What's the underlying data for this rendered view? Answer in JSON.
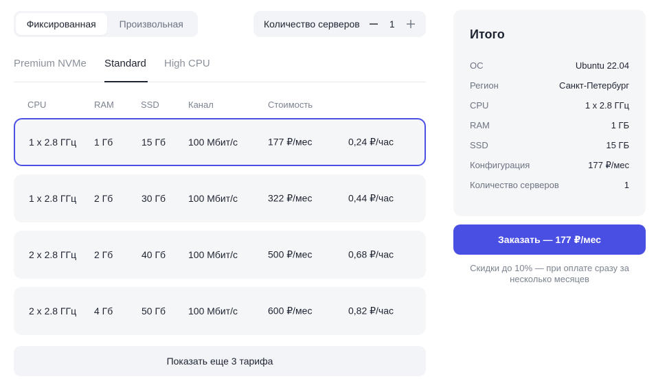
{
  "mode_toggle": {
    "fixed_label": "Фиксированная",
    "custom_label": "Произвольная"
  },
  "server_count": {
    "label": "Количество серверов",
    "value": "1",
    "minus": "—",
    "plus": "+"
  },
  "plan_tabs": [
    {
      "label": "Premium NVMe"
    },
    {
      "label": "Standard"
    },
    {
      "label": "High CPU"
    }
  ],
  "table": {
    "headers": {
      "cpu": "CPU",
      "ram": "RAM",
      "ssd": "SSD",
      "channel": "Канал",
      "price": "Стоимость"
    },
    "rows": [
      {
        "cpu": "1 x 2.8 ГГц",
        "ram": "1 Гб",
        "ssd": "15 Гб",
        "channel": "100 Мбит/с",
        "monthly": "177 ₽/мес",
        "hourly": "0,24 ₽/час"
      },
      {
        "cpu": "1 x 2.8 ГГц",
        "ram": "2 Гб",
        "ssd": "30 Гб",
        "channel": "100 Мбит/с",
        "monthly": "322 ₽/мес",
        "hourly": "0,44 ₽/час"
      },
      {
        "cpu": "2 x 2.8 ГГц",
        "ram": "2 Гб",
        "ssd": "40 Гб",
        "channel": "100 Мбит/с",
        "monthly": "500 ₽/мес",
        "hourly": "0,68 ₽/час"
      },
      {
        "cpu": "2 x 2.8 ГГц",
        "ram": "4 Гб",
        "ssd": "50 Гб",
        "channel": "100 Мбит/с",
        "monthly": "600 ₽/мес",
        "hourly": "0,82 ₽/час"
      }
    ]
  },
  "show_more_label": "Показать еще 3 тарифа",
  "summary": {
    "title": "Итого",
    "rows": [
      {
        "key": "ОС",
        "value": "Ubuntu 22.04"
      },
      {
        "key": "Регион",
        "value": "Санкт-Петербург"
      },
      {
        "key": "CPU",
        "value": "1 x 2.8 ГГц"
      },
      {
        "key": "RAM",
        "value": "1 ГБ"
      },
      {
        "key": "SSD",
        "value": "15 ГБ"
      },
      {
        "key": "Конфигурация",
        "value": "177 ₽/мес"
      },
      {
        "key": "Количество серверов",
        "value": "1"
      }
    ]
  },
  "order_button_label": "Заказать — 177 ₽/мес",
  "discount_note": "Скидки до 10% — при оплате сразу за несколько месяцев",
  "colors": {
    "accent": "#4a4fe4",
    "panel_bg": "#f5f6f8",
    "text": "#1d2330",
    "muted": "#7c8390"
  }
}
